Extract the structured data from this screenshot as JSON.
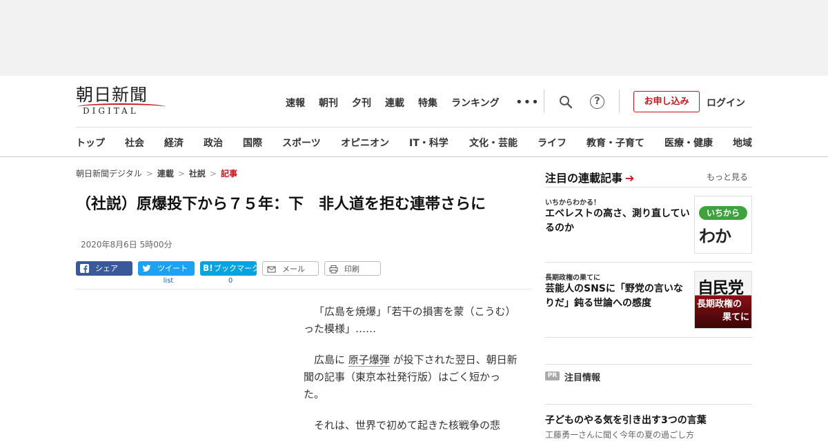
{
  "site": {
    "logo_jp": "朝日新聞",
    "logo_en": "DIGITAL"
  },
  "topnav": {
    "items": [
      "速報",
      "朝刊",
      "夕刊",
      "連載",
      "特集",
      "ランキング"
    ],
    "more_icon": "more-dots-icon",
    "search_icon": "search-icon",
    "help_icon": "help-icon",
    "help_glyph": "?",
    "apply_label": "お申し込み",
    "login_label": "ログイン"
  },
  "catnav": {
    "items": [
      "トップ",
      "社会",
      "経済",
      "政治",
      "国際",
      "スポーツ",
      "オピニオン",
      "IT・科学",
      "文化・芸能",
      "ライフ",
      "教育・子育て",
      "医療・健康",
      "地域"
    ]
  },
  "breadcrumb": {
    "items": [
      "朝日新聞デジタル",
      "連載",
      "社説"
    ],
    "current": "記事",
    "separator": ">"
  },
  "article": {
    "title": "（社説）原爆投下から７５年：下　非人道を拒む連帯さらに",
    "date": "2020年8月6日 5時00分",
    "share": {
      "facebook": "シェア",
      "twitter": "ツイート",
      "hatena": "ブックマーク",
      "mail": "メール",
      "print": "印刷",
      "twitter_count": "list",
      "hatena_count": "0"
    },
    "paragraphs": [
      "「広島を焼爆」「若干の損害を蒙（こうむ）った模様」……",
      "広島に 原子爆弾 が投下された翌日、朝日新聞の記事（東京本社発行版）はごく短かった。",
      "それは、世界で初めて起きた核戦争の悲"
    ],
    "p2": {
      "a": "広島に ",
      "link": "原子爆弾",
      "b": " が投下された翌日、朝日新聞の記事（東京本社発行版）はごく短かった。"
    }
  },
  "sidebar": {
    "heading": "注目の連載記事",
    "arrow": "➔",
    "more_label": "もっと見る",
    "items": [
      {
        "kicker": "いちからわかる！",
        "title": "エベレストの高さ、測り直しているのか",
        "thumb_line1": "いちから",
        "thumb_line2": "わかる",
        "thumb_mark": "!"
      },
      {
        "kicker": "長期政権の果てに",
        "title": "芸能人のSNSに「野党の言いなりだ」鈍る世論への感度",
        "thumb_line1": "自民党",
        "thumb_line2": "長期政権の",
        "thumb_line3": "果てに"
      }
    ],
    "pr": {
      "badge": "PR",
      "label": "注目情報",
      "title": "子どものやる気を引き出す3つの言葉",
      "sub": "工藤勇一さんに聞く今年の夏の過ごし方"
    }
  },
  "colors": {
    "accent_red": "#c4161c",
    "facebook": "#3b5998",
    "twitter": "#1da1f2",
    "hatena": "#00a4de"
  }
}
